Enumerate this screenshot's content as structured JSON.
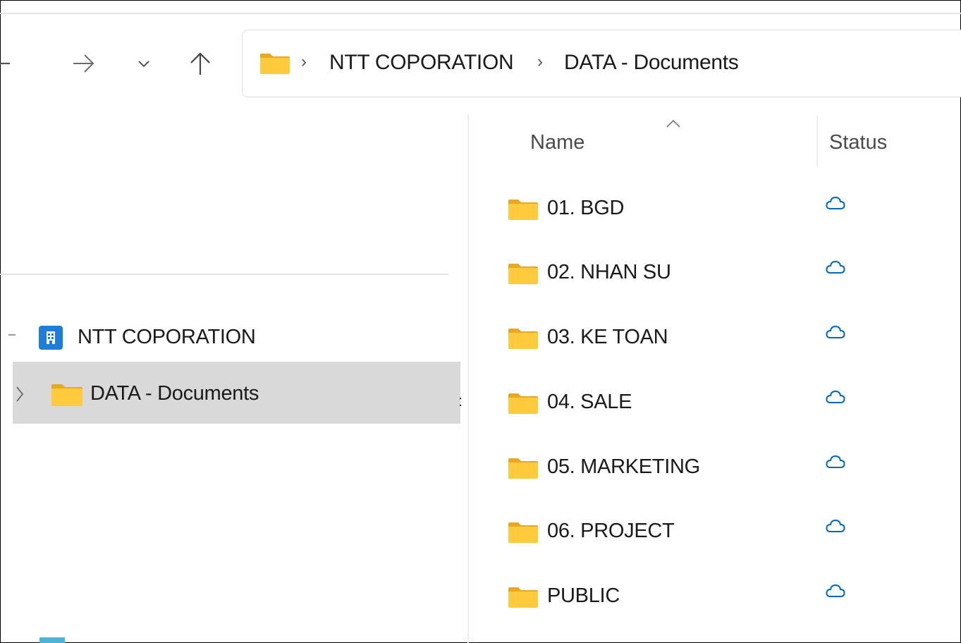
{
  "window": {
    "breadcrumb": [
      "NTT COPORATION",
      "DATA - Documents"
    ]
  },
  "nav_pane": {
    "items": [
      {
        "label": "NTT COPORATION",
        "icon": "sharepoint-site-icon",
        "selected": false
      },
      {
        "label": "DATA - Documents",
        "icon": "folder-icon",
        "selected": true
      }
    ]
  },
  "file_list": {
    "columns": {
      "name": "Name",
      "status": "Status"
    },
    "sort": {
      "column": "Name",
      "direction": "ascending"
    },
    "rows": [
      {
        "name": "01. BGD",
        "status": "cloud-icon"
      },
      {
        "name": "02. NHAN SU",
        "status": "cloud-icon"
      },
      {
        "name": "03. KE TOAN",
        "status": "cloud-icon"
      },
      {
        "name": "04. SALE",
        "status": "cloud-icon"
      },
      {
        "name": "05. MARKETING",
        "status": "cloud-icon"
      },
      {
        "name": "06. PROJECT",
        "status": "cloud-icon"
      },
      {
        "name": "PUBLIC",
        "status": "cloud-icon"
      }
    ]
  },
  "colors": {
    "folder": "#FFCB3D",
    "cloud_status": "#0067C0",
    "selection": "#D9D9D9"
  }
}
